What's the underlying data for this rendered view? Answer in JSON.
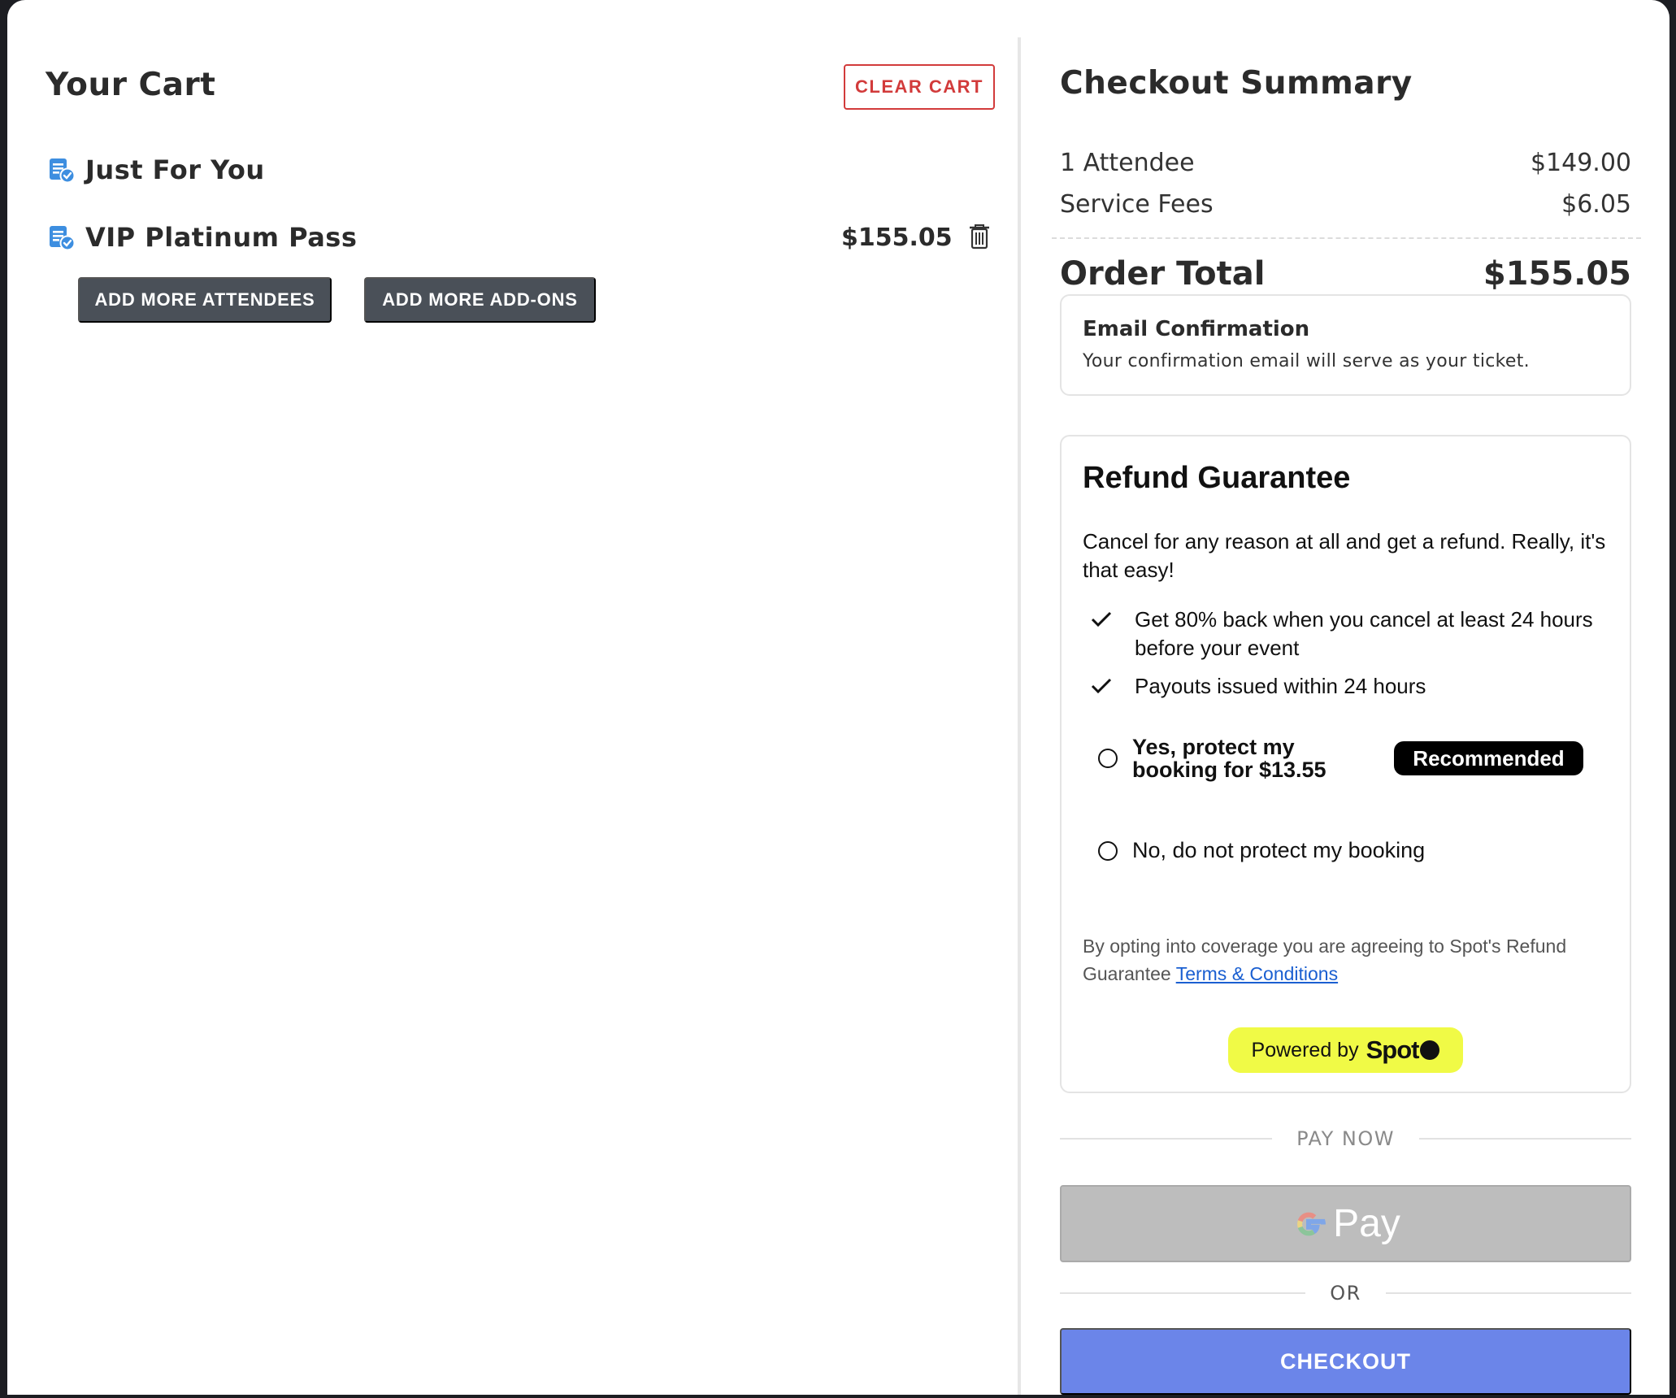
{
  "cart": {
    "title": "Your Cart",
    "clear_label": "CLEAR CART",
    "items": [
      {
        "label": "Just For You",
        "icon": "ticket-check-icon"
      },
      {
        "label": "VIP Platinum Pass",
        "price": "$155.05",
        "icon": "ticket-check-icon",
        "action_icon": "trash-icon"
      }
    ],
    "add_attendees_label": "ADD MORE ATTENDEES",
    "add_addons_label": "ADD MORE ADD-ONS"
  },
  "summary": {
    "title": "Checkout Summary",
    "lines": [
      {
        "label": "1 Attendee",
        "value": "$149.00"
      },
      {
        "label": "Service Fees",
        "value": "$6.05"
      }
    ],
    "total_label": "Order Total",
    "total_value": "$155.05",
    "email": {
      "title": "Email Confirmation",
      "text": "Your confirmation email will serve as your ticket."
    },
    "refund": {
      "title": "Refund Guarantee",
      "intro": "Cancel for any reason at all and get a refund. Really, it's that easy!",
      "bullets": [
        "Get 80% back when you cancel at least 24 hours before your event",
        "Payouts issued within 24 hours"
      ],
      "option_yes": "Yes, protect my booking for $13.55",
      "badge": "Recommended",
      "option_no": "No, do not protect my booking",
      "terms_prefix": "By opting into coverage you are agreeing to Spot's Refund Guarantee",
      "terms_link": "Terms & Conditions",
      "powered_by": "Powered by",
      "brand": "Spot"
    },
    "pay_now_label": "PAY NOW",
    "gpay_label": "Pay",
    "or_label": "OR",
    "checkout_label": "CHECKOUT"
  },
  "colors": {
    "danger": "#d23b3b",
    "dark_button": "#4a5058",
    "checkout": "#6b85e9",
    "spot_yellow": "#f0fa46",
    "icon_blue": "#3d8ee0"
  }
}
